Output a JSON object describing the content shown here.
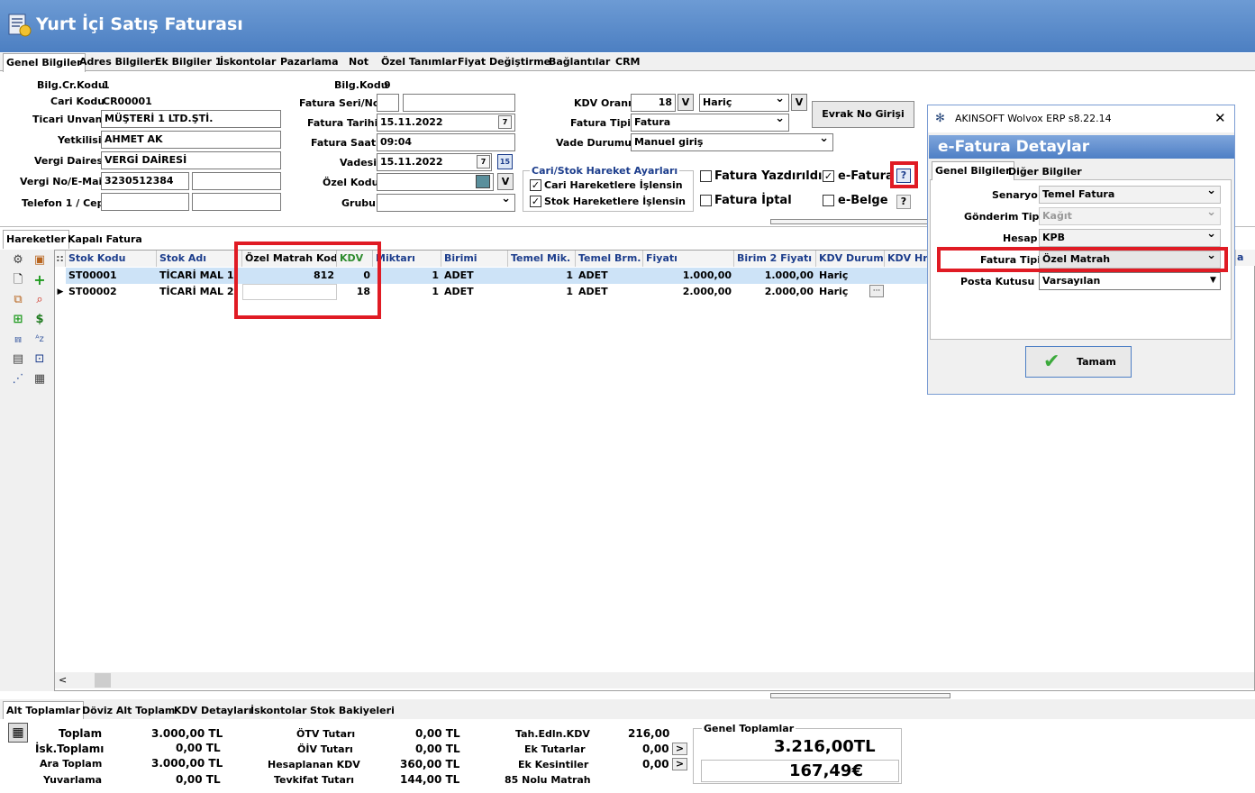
{
  "window": {
    "title": "Yurt İçi Satış Faturası"
  },
  "tabs": [
    "Genel Bilgiler",
    "Adres Bilgileri",
    "Ek Bilgiler 1",
    "İskontolar",
    "Pazarlama",
    "Not",
    "Özel Tanımlar",
    "Fiyat Değiştirme",
    "Bağlantılar",
    "CRM"
  ],
  "left": {
    "bilg_cr_kodu_label": "Bilg.Cr.Kodu",
    "bilg_cr_kodu_value": "1",
    "cari_kodu_label": "Cari Kodu",
    "cari_kodu_value": "CR00001",
    "ticari_unvani_label": "Ticari Unvanı",
    "ticari_unvani_value": "MÜŞTERİ 1 LTD.ŞTİ.",
    "yetkilisi_label": "Yetkilisi",
    "yetkilisi_value": "AHMET AK",
    "vergi_dairesi_label": "Vergi Dairesi",
    "vergi_dairesi_value": "VERGİ DAİRESİ",
    "vergi_no_label": "Vergi No/E-Mail",
    "vergi_no_value": "3230512384",
    "telefon_label": "Telefon 1 / Cep"
  },
  "mid": {
    "bilg_kodu_label": "Bilg.Kodu",
    "bilg_kodu_value": "9",
    "fatura_seri_label": "Fatura Seri/No",
    "fatura_tarihi_label": "Fatura Tarihi",
    "fatura_tarihi_value": "15.11.2022",
    "fatura_saati_label": "Fatura Saati",
    "fatura_saati_value": "09:04",
    "vadesi_label": "Vadesi",
    "vadesi_value": "15.11.2022",
    "ozel_kodu_label": "Özel Kodu",
    "grubu_label": "Grubu",
    "v_label": "V",
    "calendar_day": "7",
    "calendar_day2": "15"
  },
  "right": {
    "kdv_orani_label": "KDV Oranı",
    "kdv_orani_value": "18",
    "haric_value": "Hariç",
    "fatura_tipi_label": "Fatura Tipi",
    "fatura_tipi_value": "Fatura",
    "vade_durumu_label": "Vade Durumu",
    "vade_durumu_value": "Manuel giriş",
    "evrak_no_button": "Evrak No Girişi",
    "cari_stok_title": "Cari/Stok Hareket Ayarları",
    "cari_hareket": "Cari Hareketlere İşlensin",
    "stok_hareket": "Stok Hareketlere İşlensin",
    "fatura_yazdirildi": "Fatura Yazdırıldı",
    "fatura_iptal": "Fatura İptal",
    "e_fatura": "e-Fatura",
    "e_belge": "e-Belge",
    "help": "?"
  },
  "lower_tabs": [
    "Hareketler",
    "Kapalı Fatura"
  ],
  "grid": {
    "headers": [
      "Stok Kodu",
      "Stok Adı",
      "Özel Matrah Kodu",
      "KDV",
      "Miktarı",
      "Birimi",
      "Temel Mik.",
      "Temel Brm.",
      "Fiyatı",
      "Birim 2 Fiyatı",
      "KDV Durumu",
      "KDV Hrc"
    ],
    "rows": [
      {
        "stok_kodu": "ST00001",
        "stok_adi": "TİCARİ MAL 1",
        "ozel_matrah": "812",
        "kdv": "0",
        "miktar": "1",
        "birim": "ADET",
        "temel_mik": "1",
        "temel_brm": "ADET",
        "fiyat": "1.000,00",
        "birim2": "1.000,00",
        "kdv_durumu": "Hariç"
      },
      {
        "stok_kodu": "ST00002",
        "stok_adi": "TİCARİ MAL 2",
        "ozel_matrah": "",
        "kdv": "18",
        "miktar": "1",
        "birim": "ADET",
        "temel_mik": "1",
        "temel_brm": "ADET",
        "fiyat": "2.000,00",
        "birim2": "2.000,00",
        "kdv_durumu": "Hariç"
      }
    ],
    "ellipsis": "···",
    "scroll_left": "<"
  },
  "bottom_tabs": [
    "Alt Toplamlar",
    "Döviz Alt Toplam",
    "KDV Detayları",
    "İskontolar",
    "Stok Bakiyeleri"
  ],
  "totals": {
    "toplam_label": "Toplam",
    "toplam_value": "3.000,00 TL",
    "isk_label": "İsk.Toplamı",
    "isk_value": "0,00 TL",
    "ara_label": "Ara Toplam",
    "ara_value": "3.000,00 TL",
    "yuvarlama_label": "Yuvarlama",
    "yuvarlama_value": "0,00 TL",
    "otv_label": "ÖTV Tutarı",
    "otv_value": "0,00 TL",
    "oiv_label": "ÖİV Tutarı",
    "oiv_value": "0,00 TL",
    "hesaplanan_label": "Hesaplanan KDV",
    "hesaplanan_value": "360,00 TL",
    "tevkifat_label": "Tevkifat Tutarı",
    "tevkifat_value": "144,00 TL",
    "tah_label": "Tah.Edln.KDV",
    "tah_value": "216,00",
    "ek_tutar_label": "Ek Tutarlar",
    "ek_tutar_value": "0,00",
    "ek_kes_label": "Ek Kesintiler",
    "ek_kes_value": "0,00",
    "matrah85_label": "85 Nolu Matrah",
    "genel_label": "Genel Toplamlar",
    "genel_tl": "3.216,00TL",
    "genel_eur": "167,49€",
    "arrow": ">"
  },
  "dialog": {
    "window_title": "AKINSOFT Wolvox ERP s8.22.14",
    "close": "✕",
    "header": "e-Fatura Detaylar",
    "tabs": [
      "Genel Bilgiler",
      "Diğer Bilgiler"
    ],
    "senaryo_label": "Senaryo",
    "senaryo_value": "Temel Fatura",
    "gonderim_label": "Gönderim Tipi",
    "gonderim_value": "Kağıt",
    "hesap_label": "Hesap",
    "hesap_value": "KPB",
    "fatura_tipi_label": "Fatura Tipi",
    "fatura_tipi_value": "Özel Matrah",
    "posta_label": "Posta Kutusu",
    "posta_value": "Varsayılan",
    "ok_button": "Tamam"
  },
  "colors": {
    "title_bg": "#5a8bcb",
    "highlight": "#e01b24",
    "header_text": "#1c3d8c",
    "kdv_header": "#2e8b2e",
    "selected_row": "#cde3f7"
  }
}
